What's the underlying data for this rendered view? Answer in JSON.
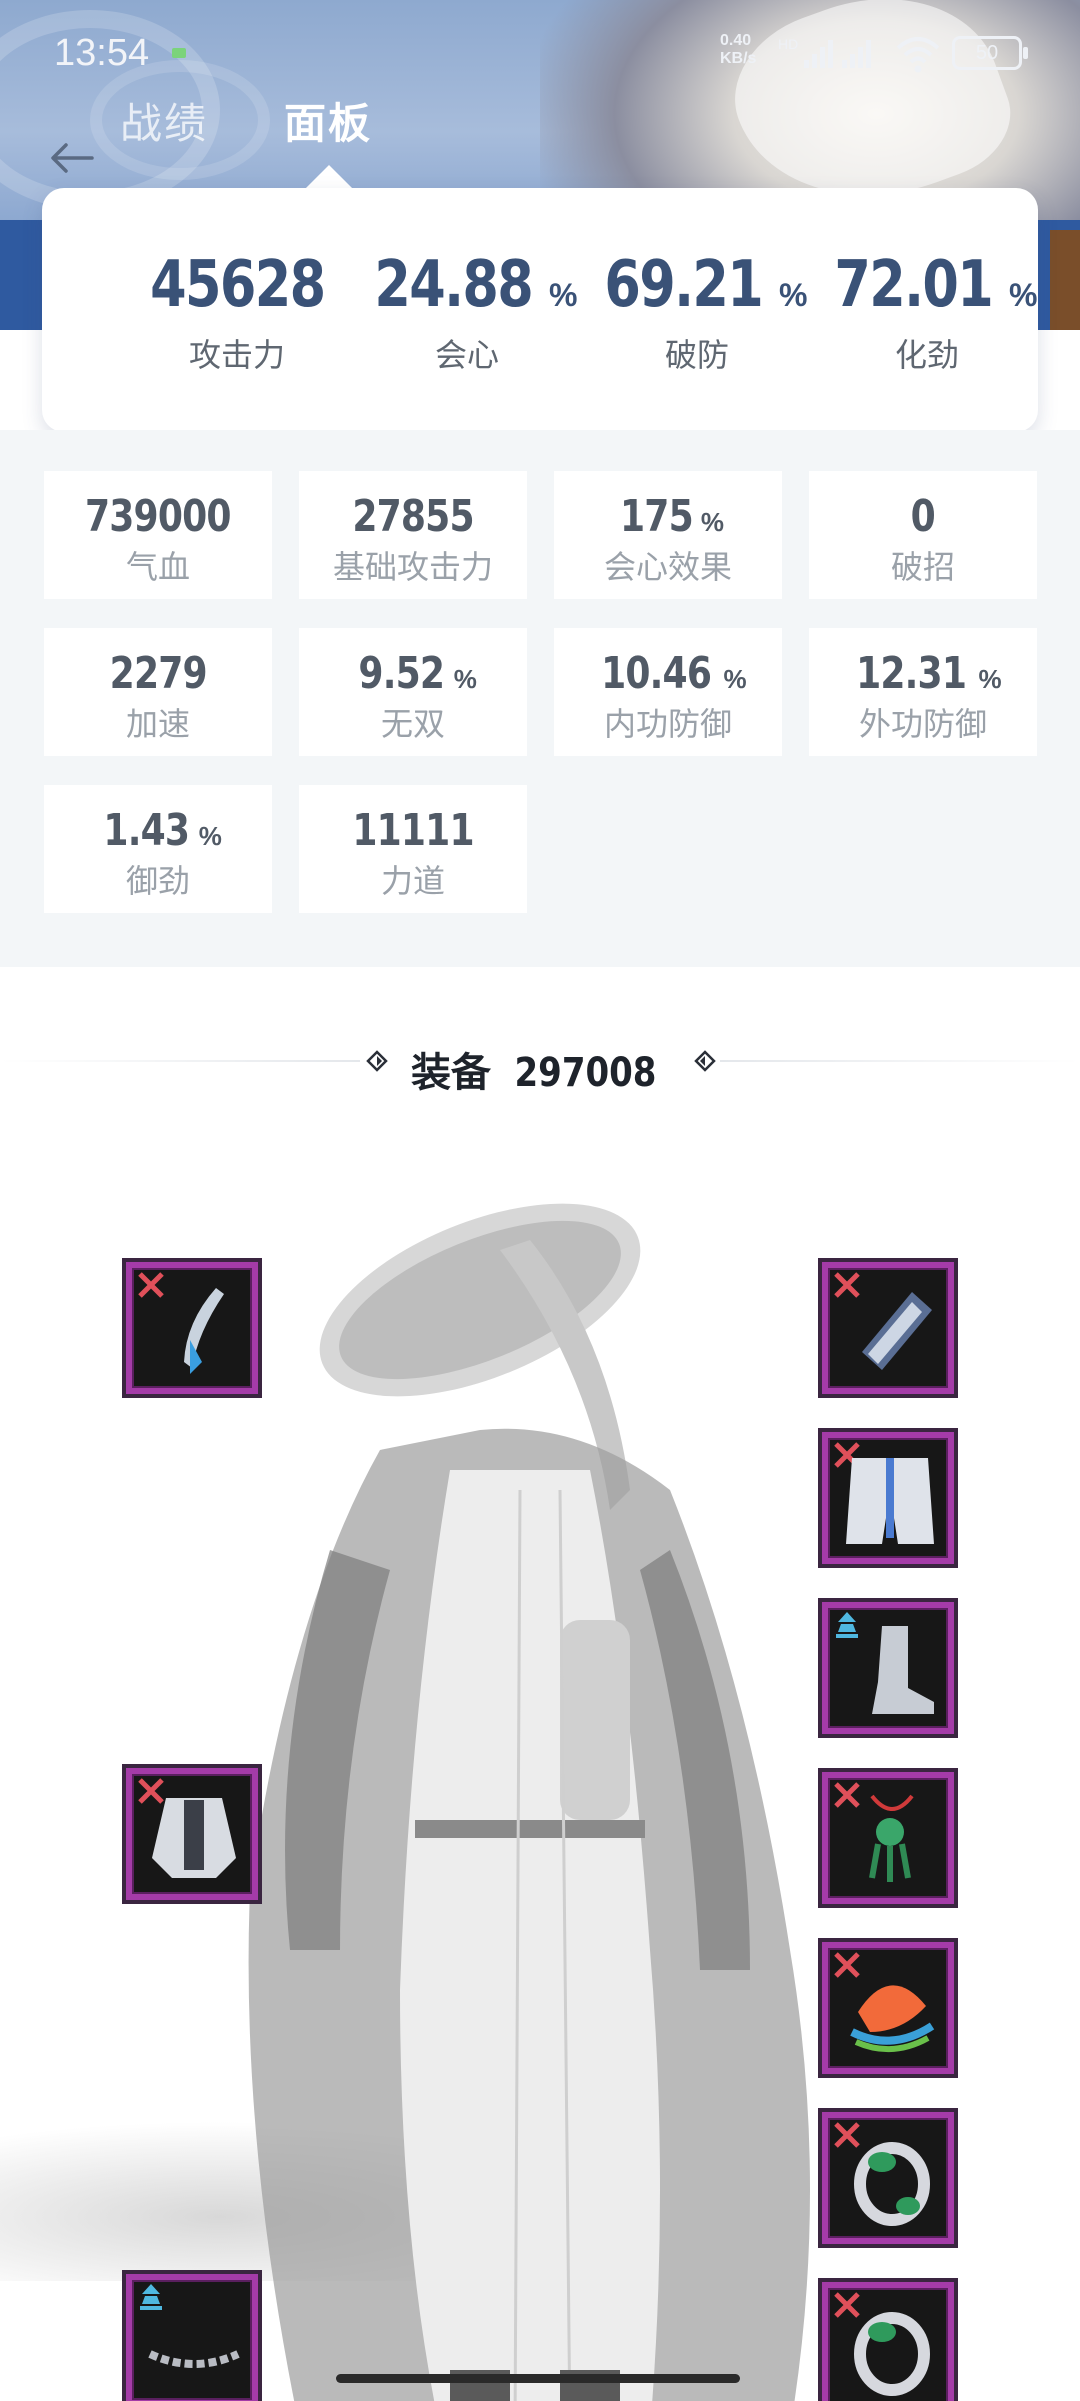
{
  "status_bar": {
    "time": "13:54",
    "net_speed": "0.40\nKB/s",
    "net_type": "HD",
    "battery": "50"
  },
  "tabs": [
    {
      "label": "战绩",
      "active": false
    },
    {
      "label": "面板",
      "active": true
    }
  ],
  "main_stats": [
    {
      "value": "45628",
      "unit": "",
      "label": "攻击力"
    },
    {
      "value": "24.88",
      "unit": "%",
      "label": "会心"
    },
    {
      "value": "69.21",
      "unit": "%",
      "label": "破防"
    },
    {
      "value": "72.01",
      "unit": "%",
      "label": "化劲"
    }
  ],
  "sub_stats": [
    {
      "value": "739000",
      "unit": "",
      "label": "气血"
    },
    {
      "value": "27855",
      "unit": "",
      "label": "基础攻击力"
    },
    {
      "value": "175",
      "unit": "%",
      "label": "会心效果"
    },
    {
      "value": "0",
      "unit": "",
      "label": "破招"
    },
    {
      "value": "2279",
      "unit": "",
      "label": "加速"
    },
    {
      "value": "9.52",
      "unit": "%",
      "label": "无双"
    },
    {
      "value": "10.46",
      "unit": "%",
      "label": "内功防御"
    },
    {
      "value": "12.31",
      "unit": "%",
      "label": "外功防御"
    },
    {
      "value": "1.43",
      "unit": "%",
      "label": "御劲"
    },
    {
      "value": "11111",
      "unit": "",
      "label": "力道"
    }
  ],
  "equipment": {
    "title": "装备",
    "score": "297008",
    "slots": [
      {
        "name": "weapon",
        "icon": "blade-icon"
      },
      {
        "name": "chest",
        "icon": "robe-icon"
      },
      {
        "name": "belt",
        "icon": "chain-belt-icon"
      },
      {
        "name": "wrist",
        "icon": "bracer-icon"
      },
      {
        "name": "pants",
        "icon": "pants-icon"
      },
      {
        "name": "boots",
        "icon": "boot-icon"
      },
      {
        "name": "pendant",
        "icon": "jade-pendant-icon"
      },
      {
        "name": "accessory",
        "icon": "fan-accessory-icon"
      },
      {
        "name": "ring1",
        "icon": "jade-ring-icon"
      },
      {
        "name": "ring2",
        "icon": "jade-ring-icon"
      }
    ]
  },
  "colors": {
    "accent": "#3a5277",
    "slot_border": "#a43ba8",
    "marker_red": "#e0505a",
    "marker_cyan": "#4fb8e0"
  }
}
